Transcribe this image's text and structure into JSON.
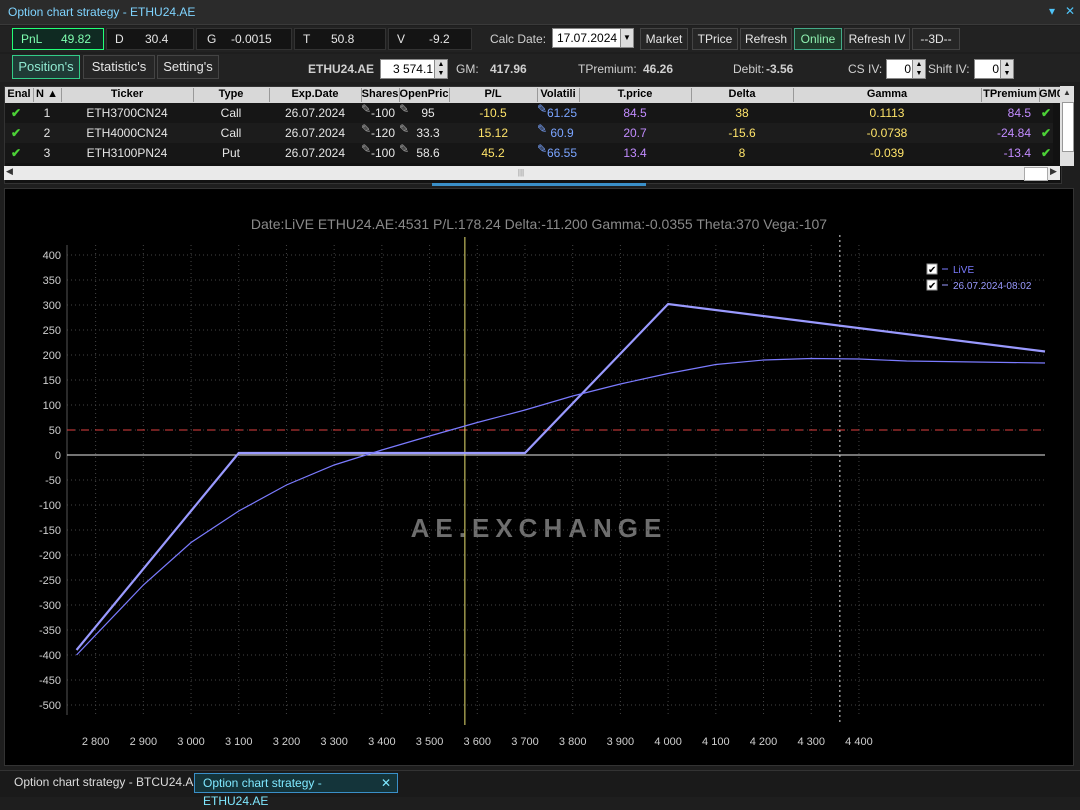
{
  "window": {
    "title": "Option chart strategy - ETHU24.AE"
  },
  "metrics": {
    "pnl_label": "PnL",
    "pnl_value": "49.82",
    "d_label": "D",
    "d_value": "30.4",
    "g_label": "G",
    "g_value": "-0.0015",
    "t_label": "T",
    "t_value": "50.8",
    "v_label": "V",
    "v_value": "-9.2"
  },
  "calc": {
    "label": "Calc Date:",
    "value": "17.07.2024"
  },
  "toolbar": {
    "market": "Market",
    "tprice": "TPrice",
    "refresh": "Refresh",
    "online": "Online",
    "refresh_iv": "Refresh IV",
    "three_d": "--3D--"
  },
  "tabs": {
    "positions": "Position's",
    "statistics": "Statistic's",
    "settings": "Setting's"
  },
  "instrument": {
    "symbol": "ETHU24.AE",
    "price": "3 574.1",
    "gm_label": "GM:",
    "gm_value": "417.96",
    "tpremium_label": "TPremium:",
    "tpremium_value": "46.26",
    "debit_label": "Debit:",
    "debit_value": "-3.56",
    "csiv_label": "CS IV:",
    "csiv_value": "0",
    "shiftiv_label": "Shift IV:",
    "shiftiv_value": "0"
  },
  "table": {
    "columns": [
      "Enal",
      "N",
      "Ticker",
      "Type",
      "Exp.Date",
      "Shares",
      "OpenPric",
      "P/L",
      "Volatili",
      "T.price",
      "Delta",
      "Gamma",
      "TPremium",
      "GM0"
    ],
    "rows": [
      {
        "n": "1",
        "ticker": "ETH3700CN24",
        "type": "Call",
        "exp": "26.07.2024",
        "shares": "-100",
        "open": "95",
        "pl": "-10.5",
        "vol": "61.25",
        "tprice": "84.5",
        "delta": "38",
        "gamma": "0.1113",
        "tprem": "84.5"
      },
      {
        "n": "2",
        "ticker": "ETH4000CN24",
        "type": "Call",
        "exp": "26.07.2024",
        "shares": "-120",
        "open": "33.3",
        "pl": "15.12",
        "vol": "60.9",
        "tprice": "20.7",
        "delta": "-15.6",
        "gamma": "-0.0738",
        "tprem": "-24.84"
      },
      {
        "n": "3",
        "ticker": "ETH3100PN24",
        "type": "Put",
        "exp": "26.07.2024",
        "shares": "-100",
        "open": "58.6",
        "pl": "45.2",
        "vol": "66.55",
        "tprice": "13.4",
        "delta": "8",
        "gamma": "-0.039",
        "tprem": "-13.4"
      }
    ]
  },
  "chart": {
    "header": "Date:LiVE  ETHU24.AE:4531  P/L:178.24  Delta:-11.200  Gamma:-0.0355  Theta:370  Vega:-107",
    "watermark": "AE.EXCHANGE",
    "legend_live": "LiVE",
    "legend_exp": "26.07.2024-08:02",
    "colors": {
      "live": "#7b7bff",
      "exp": "#9a9aff",
      "cursor": "#e8e070",
      "ref": "#e04040"
    }
  },
  "chart_data": {
    "type": "line",
    "xlim": [
      2740,
      4790
    ],
    "ylim": [
      -520,
      420
    ],
    "x_ticks": [
      2800,
      2900,
      3000,
      3100,
      3200,
      3300,
      3400,
      3500,
      3600,
      3700,
      3800,
      3900,
      4000,
      4100,
      4200,
      4300,
      4400
    ],
    "x_tick_labels": [
      "2 800",
      "2 900",
      "3 000",
      "3 100",
      "3 200",
      "3 300",
      "3 400",
      "3 500",
      "3 600",
      "3 700",
      "3 800",
      "3 900",
      "4 000",
      "4 100",
      "4 200",
      "4 300",
      "4 400"
    ],
    "y_ticks": [
      400,
      350,
      300,
      250,
      200,
      150,
      100,
      50,
      0,
      -50,
      -100,
      -150,
      -200,
      -250,
      -300,
      -350,
      -400,
      -450,
      -500
    ],
    "series": [
      {
        "name": "26.07.2024-08:02",
        "x": [
          2760,
          3100,
          3700,
          4000,
          4790
        ],
        "y": [
          -390,
          4,
          4,
          302,
          207
        ]
      },
      {
        "name": "LiVE",
        "x": [
          2760,
          2900,
          3000,
          3100,
          3200,
          3300,
          3400,
          3500,
          3600,
          3700,
          3800,
          3900,
          4000,
          4100,
          4200,
          4300,
          4400,
          4500,
          4790
        ],
        "y": [
          -400,
          -260,
          -175,
          -112,
          -60,
          -20,
          10,
          38,
          65,
          90,
          118,
          142,
          163,
          181,
          190,
          193,
          192,
          188,
          184
        ]
      }
    ],
    "ref_line": 50,
    "cursor_x": 3574,
    "marker_x": 4360
  },
  "bottom_tabs": {
    "tab1": "Option chart strategy - BTCU24.AE",
    "tab2": "Option chart strategy - ETHU24.AE"
  }
}
